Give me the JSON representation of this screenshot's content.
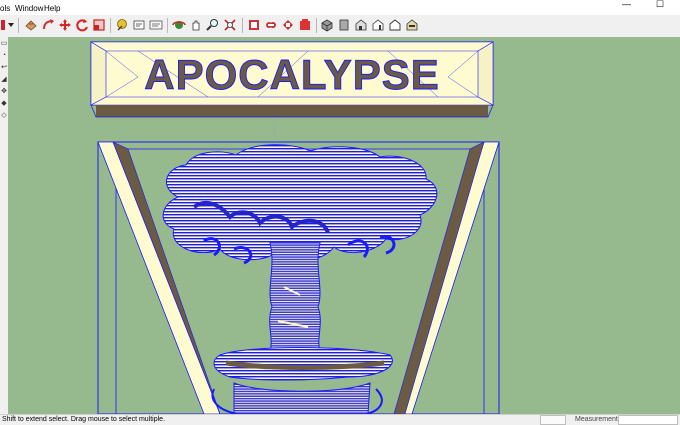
{
  "menu": {
    "items": [
      "ols",
      "Window",
      "Help"
    ]
  },
  "window_controls": {
    "minimize": "—",
    "maximize": "☐"
  },
  "toolbar": {
    "icons": [
      "paint-bucket-icon",
      "push-pull-icon",
      "follow-me-icon",
      "move-icon",
      "rotate-icon",
      "scale-icon",
      "tape-measure-icon",
      "dimension-icon",
      "text-icon",
      "axes-icon",
      "orbit-icon",
      "pan-icon",
      "zoom-icon",
      "zoom-extents-icon",
      "warehouse-icon",
      "extension-warehouse-icon",
      "share-model-icon",
      "iso-view-icon",
      "top-view-icon",
      "front-view-icon",
      "right-view-icon",
      "back-view-icon",
      "left-view-icon"
    ]
  },
  "left_tools": [
    "rect-tool",
    "circle-tool",
    "arrow-tool",
    "eraser-tool",
    "move-tool",
    "rotate-tool",
    "offset-tool"
  ],
  "model": {
    "banner_text": "APOCALYPSE"
  },
  "status": {
    "hint": "Shift to extend select. Drag mouse to select multiple.",
    "measurements_label": "Measurements",
    "measurements_value": ""
  },
  "colors": {
    "viewport_bg": "#97b98e",
    "face_front": "#fffbd0",
    "face_back": "#6b5a44",
    "edge": "#1a1aff"
  }
}
